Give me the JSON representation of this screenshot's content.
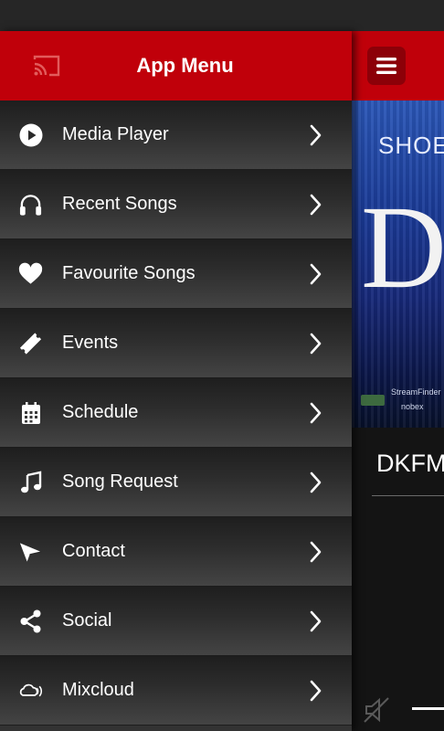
{
  "drawer": {
    "title": "App Menu",
    "items": [
      {
        "label": "Media Player",
        "icon": "play-circle-icon"
      },
      {
        "label": "Recent Songs",
        "icon": "headphones-icon"
      },
      {
        "label": "Favourite Songs",
        "icon": "heart-icon"
      },
      {
        "label": "Events",
        "icon": "ticket-icon"
      },
      {
        "label": "Schedule",
        "icon": "calendar-icon"
      },
      {
        "label": "Song Request",
        "icon": "music-note-icon"
      },
      {
        "label": "Contact",
        "icon": "paper-plane-icon"
      },
      {
        "label": "Social",
        "icon": "share-icon"
      },
      {
        "label": "Mixcloud",
        "icon": "mixcloud-icon"
      }
    ]
  },
  "background_app": {
    "artwork_top_text": "SHOE",
    "artwork_letter": "D",
    "artwork_small_text": "StreamFinder",
    "artwork_small_text2": "nobex",
    "station_name": "DKFM"
  },
  "colors": {
    "accent_red": "#c0000a",
    "dark_red_button": "#8c0008"
  }
}
